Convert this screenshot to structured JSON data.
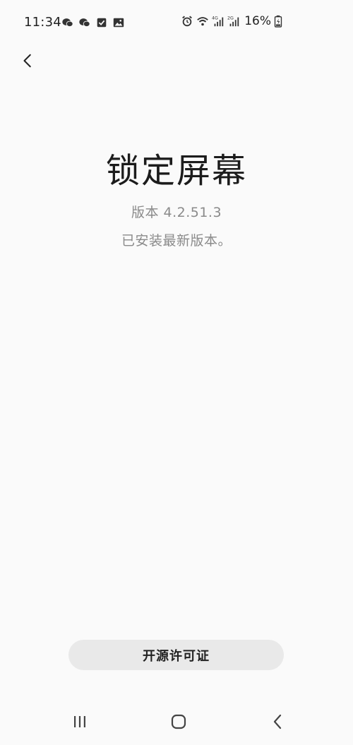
{
  "status_bar": {
    "time": "11:34",
    "battery_percent": "16%",
    "left_icons": [
      "wechat-icon",
      "wechat-icon",
      "checkbox-icon",
      "gallery-icon"
    ],
    "right_icons": [
      "alarm-icon",
      "wifi-icon",
      "signal-4g-icon",
      "signal-2g-icon",
      "battery-charging-icon"
    ]
  },
  "header": {
    "back_icon": "chevron-left-icon"
  },
  "main": {
    "app_title": "锁定屏幕",
    "version": "版本 4.2.51.3",
    "update_status": "已安装最新版本。"
  },
  "footer": {
    "license_button_label": "开源许可证"
  },
  "nav_bar": {
    "icons": [
      "recent-apps-icon",
      "home-icon",
      "back-icon"
    ]
  },
  "colors": {
    "background": "#fafafa",
    "title_text": "#1c1c1c",
    "secondary_text": "#8a8a8a",
    "button_bg": "#e9e9e9"
  }
}
